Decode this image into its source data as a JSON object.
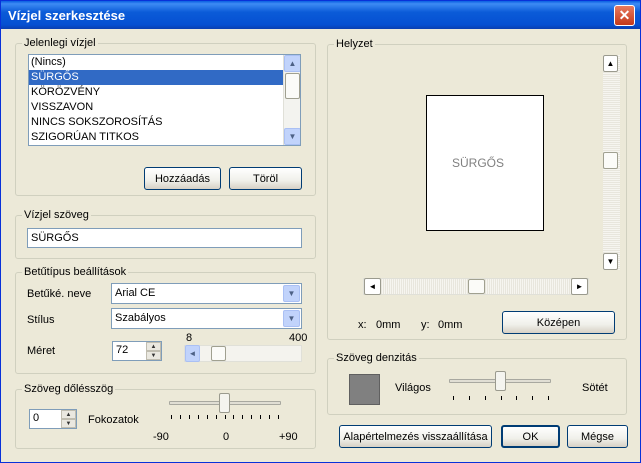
{
  "window": {
    "title": "Vízjel szerkesztése",
    "close_label": "✕"
  },
  "current_watermark": {
    "legend": "Jelenlegi vízjel",
    "items": [
      "(Nincs)",
      "SÜRGŐS",
      "KÖRÖZVÉNY",
      "VISSZAVON",
      "NINCS SOKSZOROSÍTÁS",
      "SZIGORÚAN TITKOS"
    ],
    "selected_index": 1,
    "add_button": "Hozzáadás",
    "delete_button": "Töröl"
  },
  "watermark_text": {
    "legend": "Vízjel szöveg",
    "value": "SÜRGŐS"
  },
  "font_settings": {
    "legend": "Betűtípus beállítások",
    "font_name_label": "Betűké. neve",
    "font_name_value": "Arial CE",
    "style_label": "Stílus",
    "style_value": "Szabályos",
    "size_label": "Méret",
    "size_value": "72",
    "size_min_label": "8",
    "size_max_label": "400"
  },
  "angle": {
    "legend": "Szöveg dőlésszög",
    "value": "0",
    "unit_label": "Fokozatok",
    "min_label": "-90",
    "mid_label": "0",
    "max_label": "+90"
  },
  "position": {
    "legend": "Helyzet",
    "preview_text": "SÜRGŐS",
    "x_label": "x:",
    "x_value": "0mm",
    "y_label": "y:",
    "y_value": "0mm",
    "center_button": "Középen"
  },
  "density": {
    "legend": "Szöveg denzitás",
    "light_label": "Világos",
    "dark_label": "Sötét",
    "swatch_color": "#808080"
  },
  "footer": {
    "reset_button": "Alapértelmezés visszaállítása",
    "ok_button": "OK",
    "cancel_button": "Mégse"
  },
  "colors": {
    "selection": "#316ac5",
    "titlebar": "#0550d2"
  },
  "icons": {
    "close": "close-icon",
    "scroll_up": "arrow-up-icon",
    "scroll_down": "arrow-down-icon",
    "scroll_left": "arrow-left-icon",
    "scroll_right": "arrow-right-icon",
    "dropdown": "chevron-down-icon"
  }
}
